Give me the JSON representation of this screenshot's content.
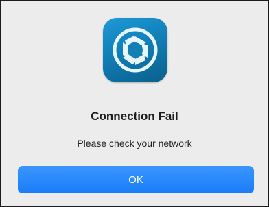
{
  "dialog": {
    "title": "Connection Fail",
    "message": "Please check your network",
    "ok_label": "OK"
  },
  "icons": {
    "app_icon": "camera-aperture-icon"
  },
  "colors": {
    "button_blue": "#1a7df8",
    "icon_blue": "#117fb8",
    "background": "#ececec"
  }
}
